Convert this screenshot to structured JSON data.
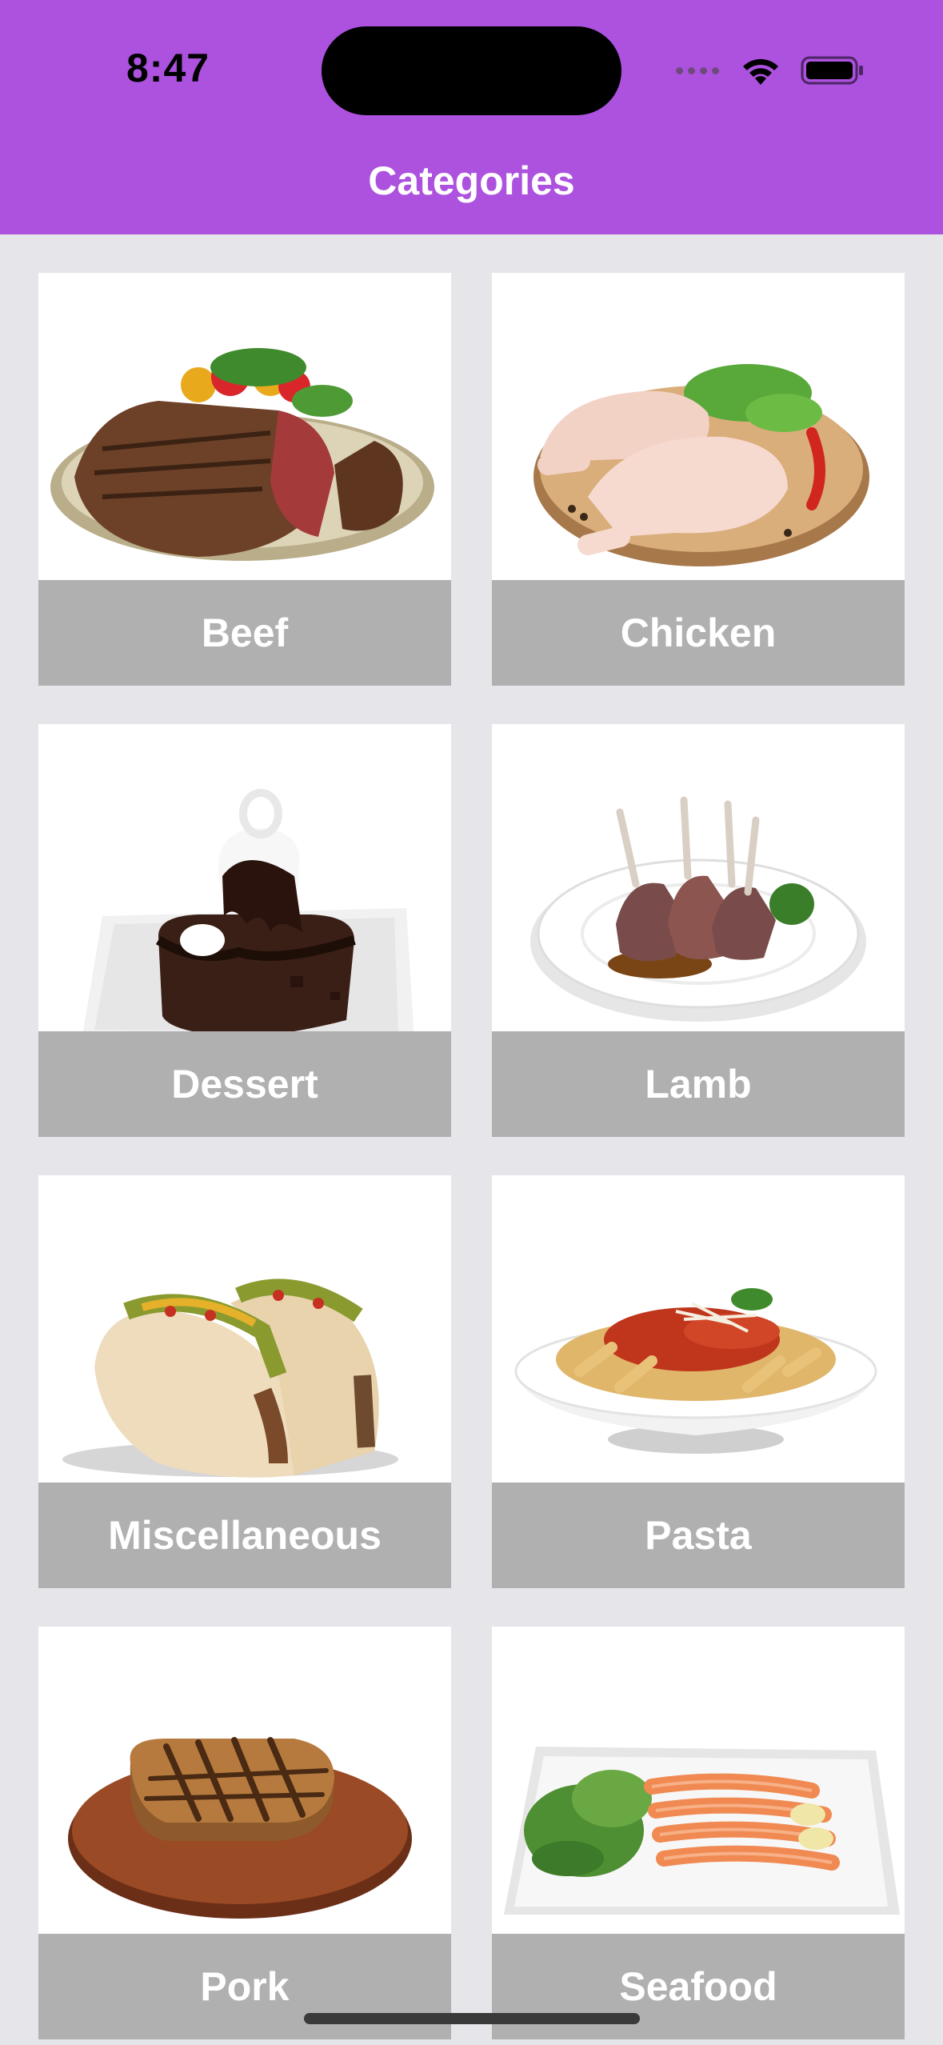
{
  "status_bar": {
    "time": "8:47",
    "wifi_icon": "wifi-icon",
    "battery_icon": "battery-full-icon"
  },
  "header": {
    "title": "Categories",
    "background": "#ac52de"
  },
  "categories": [
    {
      "label": "Beef",
      "image": "steak-plate-image"
    },
    {
      "label": "Chicken",
      "image": "raw-chicken-board-image"
    },
    {
      "label": "Dessert",
      "image": "chocolate-lava-cake-image"
    },
    {
      "label": "Lamb",
      "image": "lamb-chops-plate-image"
    },
    {
      "label": "Miscellaneous",
      "image": "tacos-image"
    },
    {
      "label": "Pasta",
      "image": "penne-pasta-bowl-image"
    },
    {
      "label": "Pork",
      "image": "pork-chop-board-image"
    },
    {
      "label": "Seafood",
      "image": "salmon-sashimi-plate-image"
    }
  ],
  "colors": {
    "label_band": "#b0b0b0",
    "page_background": "#e5e5ea"
  }
}
